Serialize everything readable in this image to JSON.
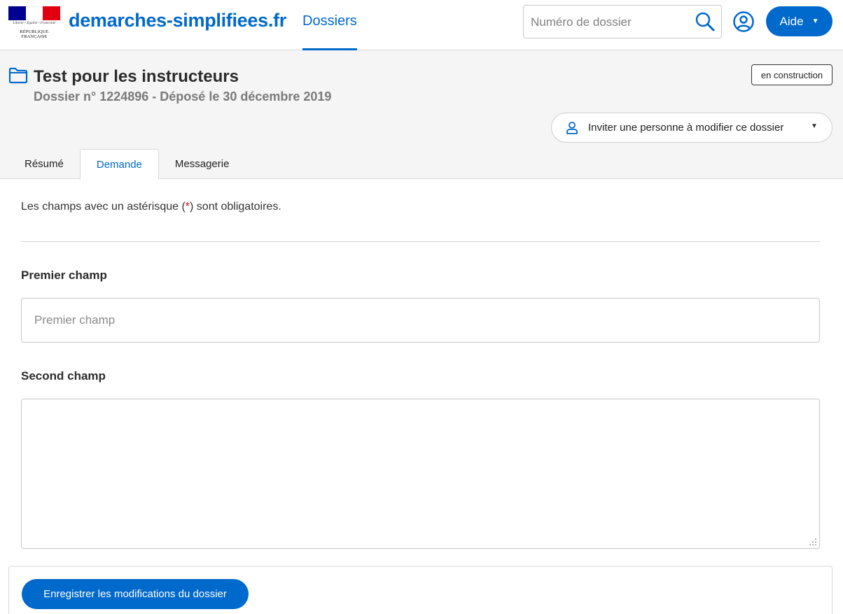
{
  "header": {
    "logo": {
      "motto": "Liberté • Égalité • Fraternité",
      "name": "RÉPUBLIQUE FRANÇAISE",
      "flag_colors": [
        "#000091",
        "#ffffff",
        "#e1000f"
      ]
    },
    "brand": "demarches-simplifiees.fr",
    "nav_item": "Dossiers",
    "search": {
      "placeholder": "Numéro de dossier",
      "value": ""
    },
    "help_button": "Aide"
  },
  "procedure": {
    "title": "Test pour les instructeurs",
    "subtitle": "Dossier n° 1224896 - Déposé le 30 décembre 2019",
    "status_badge": "en construction",
    "invite_button": "Inviter une personne à modifier ce dossier"
  },
  "tabs": [
    {
      "label": "Résumé",
      "active": false
    },
    {
      "label": "Demande",
      "active": true
    },
    {
      "label": "Messagerie",
      "active": false
    }
  ],
  "form": {
    "notice_before": "Les champs avec un astérisque (",
    "notice_star": "*",
    "notice_after": ") sont obligatoires.",
    "fields": [
      {
        "label": "Premier champ",
        "placeholder": "Premier champ",
        "value": ""
      },
      {
        "label": "Second champ",
        "value": ""
      }
    ],
    "submit_label": "Enregistrer les modifications du dossier"
  },
  "colors": {
    "accent": "#0069cc",
    "required_star": "#d0021b",
    "subheader_bg": "#f5f5f5"
  }
}
